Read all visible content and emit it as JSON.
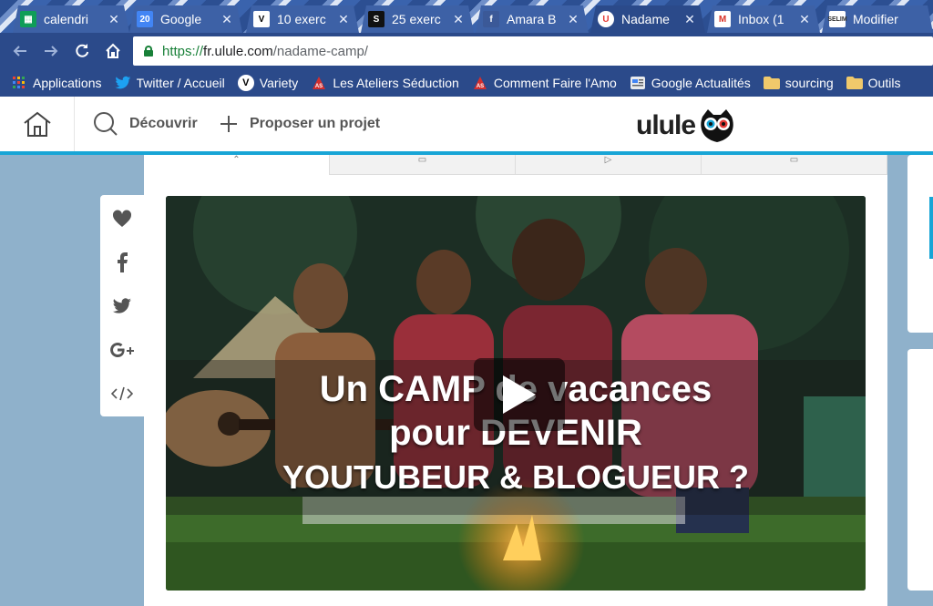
{
  "browser": {
    "tabs": [
      {
        "label": "calendri",
        "icon": "sheets-icon",
        "color": "#0f9d58"
      },
      {
        "label": "Google",
        "icon": "calendar-icon",
        "color": "#4285f4"
      },
      {
        "label": "10 exerc",
        "icon": "variety-icon",
        "color": "#ffffff"
      },
      {
        "label": "25 exerc",
        "icon": "s-logo-icon",
        "color": "#111111"
      },
      {
        "label": "Amara B",
        "icon": "facebook-icon",
        "color": "#3b5998"
      },
      {
        "label": "Nadame",
        "icon": "ulule-icon",
        "color": "#e53935"
      },
      {
        "label": "Inbox (1",
        "icon": "gmail-icon",
        "color": "#ffffff"
      },
      {
        "label": "Modifier",
        "icon": "selim-icon",
        "color": "#ffffff"
      }
    ],
    "url": {
      "secure_prefix": "https://",
      "host": "fr.ulule.com",
      "path": "/nadame-camp/"
    },
    "bookmarks": [
      {
        "label": "Applications",
        "icon": "apps-grid-icon"
      },
      {
        "label": "Twitter / Accueil",
        "icon": "twitter-icon"
      },
      {
        "label": "Variety",
        "icon": "variety-icon"
      },
      {
        "label": "Les Ateliers Séduction",
        "icon": "ateliers-icon"
      },
      {
        "label": "Comment Faire l'Amo",
        "icon": "ateliers-icon"
      },
      {
        "label": "Google Actualités",
        "icon": "news-icon"
      },
      {
        "label": "sourcing",
        "icon": "folder-icon"
      },
      {
        "label": "Outils",
        "icon": "folder-icon"
      }
    ]
  },
  "header": {
    "discover_label": "Découvrir",
    "propose_label": "Proposer un projet",
    "logo_text": "ulule",
    "accent_color": "#18a5d6"
  },
  "video": {
    "line1": "Un CAMP de vacances",
    "line2": "pour DEVENIR",
    "line3": "YOUTUBEUR & BLOGUEUR ?"
  }
}
